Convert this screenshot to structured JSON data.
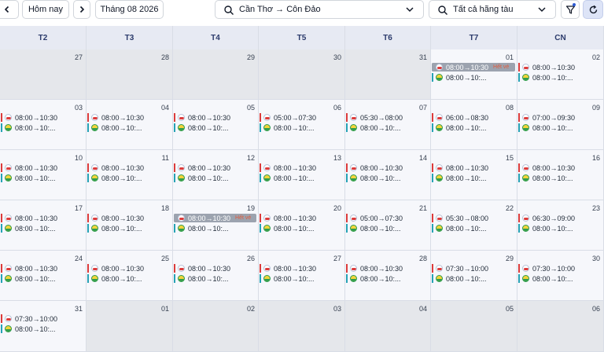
{
  "toolbar": {
    "prev_label": "‹",
    "today_label": "Hôm nay",
    "next_label": "›",
    "month_label": "Tháng 08 2026",
    "route_label": "Cần Thơ → Côn Đảo",
    "operator_label": "Tất cả hãng tàu"
  },
  "weekdays": [
    "T2",
    "T3",
    "T4",
    "T5",
    "T6",
    "T7",
    "CN"
  ],
  "colors": {
    "red": "#dc3b3b",
    "teal": "#26a2b5",
    "header": "#e7eaf3",
    "outside": "#e5e7eb"
  },
  "icons": [
    "chevron-left-icon",
    "chevron-right-icon",
    "search-icon",
    "chevron-down-icon",
    "filter-icon",
    "refresh-icon"
  ],
  "weeks": [
    [
      {
        "day": "27",
        "out": true,
        "events": []
      },
      {
        "day": "28",
        "out": true,
        "events": []
      },
      {
        "day": "29",
        "out": true,
        "events": []
      },
      {
        "day": "30",
        "out": true,
        "events": []
      },
      {
        "day": "31",
        "out": true,
        "events": []
      },
      {
        "day": "01",
        "out": false,
        "events": [
          {
            "time": "08:00→10:30",
            "kind": "r",
            "sold": true,
            "tag": "Hết vé"
          },
          {
            "time": "08:00→10:...",
            "kind": "t"
          }
        ]
      },
      {
        "day": "02",
        "out": false,
        "events": [
          {
            "time": "08:00→10:30",
            "kind": "r"
          },
          {
            "time": "08:00→10:...",
            "kind": "t"
          }
        ]
      }
    ],
    [
      {
        "day": "03",
        "out": false,
        "events": [
          {
            "time": "08:00→10:30",
            "kind": "r"
          },
          {
            "time": "08:00→10:...",
            "kind": "t"
          }
        ]
      },
      {
        "day": "04",
        "out": false,
        "events": [
          {
            "time": "08:00→10:30",
            "kind": "r"
          },
          {
            "time": "08:00→10:...",
            "kind": "t"
          }
        ]
      },
      {
        "day": "05",
        "out": false,
        "events": [
          {
            "time": "08:00→10:30",
            "kind": "r"
          },
          {
            "time": "08:00→10:...",
            "kind": "t"
          }
        ]
      },
      {
        "day": "06",
        "out": false,
        "events": [
          {
            "time": "05:00→07:30",
            "kind": "r"
          },
          {
            "time": "08:00→10:...",
            "kind": "t"
          }
        ]
      },
      {
        "day": "07",
        "out": false,
        "events": [
          {
            "time": "05:30→08:00",
            "kind": "r"
          },
          {
            "time": "08:00→10:...",
            "kind": "t"
          }
        ]
      },
      {
        "day": "08",
        "out": false,
        "events": [
          {
            "time": "06:00→08:30",
            "kind": "r"
          },
          {
            "time": "08:00→10:...",
            "kind": "t"
          }
        ]
      },
      {
        "day": "09",
        "out": false,
        "events": [
          {
            "time": "07:00→09:30",
            "kind": "r"
          },
          {
            "time": "08:00→10:...",
            "kind": "t"
          }
        ]
      }
    ],
    [
      {
        "day": "10",
        "out": false,
        "events": [
          {
            "time": "08:00→10:30",
            "kind": "r"
          },
          {
            "time": "08:00→10:...",
            "kind": "t"
          }
        ]
      },
      {
        "day": "11",
        "out": false,
        "events": [
          {
            "time": "08:00→10:30",
            "kind": "r"
          },
          {
            "time": "08:00→10:...",
            "kind": "t"
          }
        ]
      },
      {
        "day": "12",
        "out": false,
        "events": [
          {
            "time": "08:00→10:30",
            "kind": "r"
          },
          {
            "time": "08:00→10:...",
            "kind": "t"
          }
        ]
      },
      {
        "day": "13",
        "out": false,
        "events": [
          {
            "time": "08:00→10:30",
            "kind": "r"
          },
          {
            "time": "08:00→10:...",
            "kind": "t"
          }
        ]
      },
      {
        "day": "14",
        "out": false,
        "events": [
          {
            "time": "08:00→10:30",
            "kind": "r"
          },
          {
            "time": "08:00→10:...",
            "kind": "t"
          }
        ]
      },
      {
        "day": "15",
        "out": false,
        "events": [
          {
            "time": "08:00→10:30",
            "kind": "r"
          },
          {
            "time": "08:00→10:...",
            "kind": "t"
          }
        ]
      },
      {
        "day": "16",
        "out": false,
        "events": [
          {
            "time": "08:00→10:30",
            "kind": "r"
          },
          {
            "time": "08:00→10:...",
            "kind": "t"
          }
        ]
      }
    ],
    [
      {
        "day": "17",
        "out": false,
        "events": [
          {
            "time": "08:00→10:30",
            "kind": "r"
          },
          {
            "time": "08:00→10:...",
            "kind": "t"
          }
        ]
      },
      {
        "day": "18",
        "out": false,
        "events": [
          {
            "time": "08:00→10:30",
            "kind": "r"
          },
          {
            "time": "08:00→10:...",
            "kind": "t"
          }
        ]
      },
      {
        "day": "19",
        "out": false,
        "events": [
          {
            "time": "08:00→10:30",
            "kind": "r",
            "sold": true,
            "tag": "Hết vé"
          },
          {
            "time": "08:00→10:...",
            "kind": "t"
          }
        ]
      },
      {
        "day": "20",
        "out": false,
        "events": [
          {
            "time": "08:00→10:30",
            "kind": "r"
          },
          {
            "time": "08:00→10:...",
            "kind": "t"
          }
        ]
      },
      {
        "day": "21",
        "out": false,
        "events": [
          {
            "time": "05:00→07:30",
            "kind": "r"
          },
          {
            "time": "08:00→10:...",
            "kind": "t"
          }
        ]
      },
      {
        "day": "22",
        "out": false,
        "events": [
          {
            "time": "05:30→08:00",
            "kind": "r"
          },
          {
            "time": "08:00→10:...",
            "kind": "t"
          }
        ]
      },
      {
        "day": "23",
        "out": false,
        "events": [
          {
            "time": "06:30→09:00",
            "kind": "r"
          },
          {
            "time": "08:00→10:...",
            "kind": "t"
          }
        ]
      }
    ],
    [
      {
        "day": "24",
        "out": false,
        "events": [
          {
            "time": "08:00→10:30",
            "kind": "r"
          },
          {
            "time": "08:00→10:...",
            "kind": "t"
          }
        ]
      },
      {
        "day": "25",
        "out": false,
        "events": [
          {
            "time": "08:00→10:30",
            "kind": "r"
          },
          {
            "time": "08:00→10:...",
            "kind": "t"
          }
        ]
      },
      {
        "day": "26",
        "out": false,
        "events": [
          {
            "time": "08:00→10:30",
            "kind": "r"
          },
          {
            "time": "08:00→10:...",
            "kind": "t"
          }
        ]
      },
      {
        "day": "27",
        "out": false,
        "events": [
          {
            "time": "08:00→10:30",
            "kind": "r"
          },
          {
            "time": "08:00→10:...",
            "kind": "t"
          }
        ]
      },
      {
        "day": "28",
        "out": false,
        "events": [
          {
            "time": "08:00→10:30",
            "kind": "r"
          },
          {
            "time": "08:00→10:...",
            "kind": "t"
          }
        ]
      },
      {
        "day": "29",
        "out": false,
        "events": [
          {
            "time": "07:30→10:00",
            "kind": "r"
          },
          {
            "time": "08:00→10:...",
            "kind": "t"
          }
        ]
      },
      {
        "day": "30",
        "out": false,
        "events": [
          {
            "time": "07:30→10:00",
            "kind": "r"
          },
          {
            "time": "08:00→10:...",
            "kind": "t"
          }
        ]
      }
    ],
    [
      {
        "day": "31",
        "out": false,
        "events": [
          {
            "time": "07:30→10:00",
            "kind": "r"
          },
          {
            "time": "08:00→10:...",
            "kind": "t"
          }
        ]
      },
      {
        "day": "01",
        "out": true,
        "events": []
      },
      {
        "day": "02",
        "out": true,
        "events": []
      },
      {
        "day": "03",
        "out": true,
        "events": []
      },
      {
        "day": "04",
        "out": true,
        "events": []
      },
      {
        "day": "05",
        "out": true,
        "events": []
      },
      {
        "day": "06",
        "out": true,
        "events": []
      }
    ]
  ]
}
